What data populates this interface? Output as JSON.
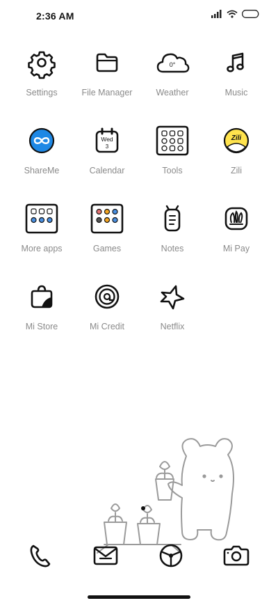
{
  "status_bar": {
    "time": "2:36 AM",
    "icons": [
      "signal-icon",
      "wifi-icon",
      "battery-icon"
    ]
  },
  "apps": [
    {
      "label": "Settings",
      "icon": "gear-icon"
    },
    {
      "label": "File Manager",
      "icon": "folder-icon"
    },
    {
      "label": "Weather",
      "icon": "cloud-icon",
      "badge": "0°"
    },
    {
      "label": "Music",
      "icon": "music-note-icon"
    },
    {
      "label": "ShareMe",
      "icon": "shareme-icon"
    },
    {
      "label": "Calendar",
      "icon": "calendar-icon",
      "day": "Wed",
      "date": "3"
    },
    {
      "label": "Tools",
      "icon": "tools-folder-icon"
    },
    {
      "label": "Zili",
      "icon": "zili-icon",
      "badge": "Zili"
    },
    {
      "label": "More apps",
      "icon": "more-apps-folder-icon"
    },
    {
      "label": "Games",
      "icon": "games-folder-icon"
    },
    {
      "label": "Notes",
      "icon": "notes-icon"
    },
    {
      "label": "Mi Pay",
      "icon": "mi-pay-icon"
    },
    {
      "label": "Mi Store",
      "icon": "shopping-bag-icon"
    },
    {
      "label": "Mi Credit",
      "icon": "mi-credit-icon"
    },
    {
      "label": "Netflix",
      "icon": "netflix-star-icon"
    }
  ],
  "dock": [
    {
      "icon": "phone-icon"
    },
    {
      "icon": "messages-icon"
    },
    {
      "icon": "browser-icon"
    },
    {
      "icon": "camera-icon"
    }
  ],
  "colors": {
    "accent_blue": "#1e88e5",
    "zili_yellow": "#ffe34d",
    "label_gray": "#8a8a8a"
  }
}
